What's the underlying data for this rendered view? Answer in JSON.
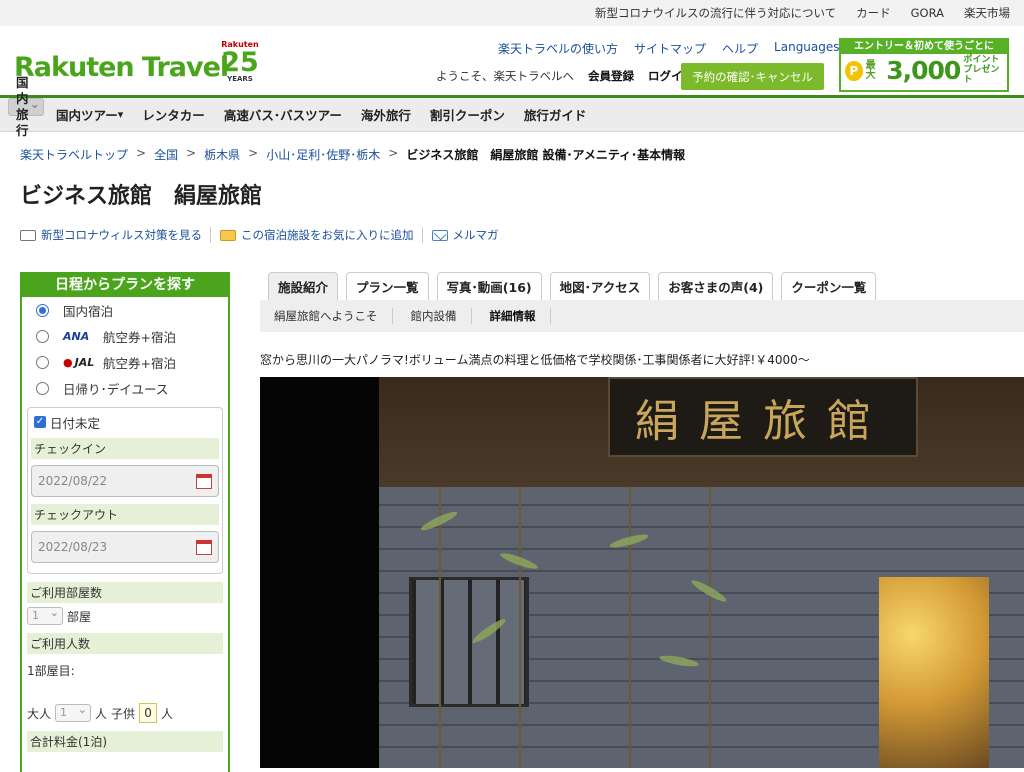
{
  "topbar": {
    "links": [
      "新型コロナウイルスの流行に伴う対応について",
      "カード",
      "GORA",
      "楽天市場"
    ]
  },
  "header": {
    "logo": "Rakuten Travel",
    "anniv": {
      "brand": "Rakuten",
      "number": "25",
      "word": "YEARS"
    },
    "links": [
      "楽天トラベルの使い方",
      "サイトマップ",
      "ヘルプ",
      "Languages"
    ],
    "welcome": "ようこそ、楽天トラベルへ",
    "register": "会員登録",
    "login": "ログイン",
    "reservation": "予約の確認･キャンセル",
    "promo": {
      "top": "エントリー＆初めて使うごとに",
      "coin": "P",
      "max": "最大",
      "amount": "3,000",
      "unit1": "ポイント",
      "unit2": "プレゼント"
    }
  },
  "nav": [
    "国内旅行",
    "国内ツアー",
    "レンタカー",
    "高速バス･バスツアー",
    "海外旅行",
    "割引クーポン",
    "旅行ガイド"
  ],
  "breadcrumb": {
    "items": [
      "楽天トラベルトップ",
      "全国",
      "栃木県",
      "小山･足利･佐野･栃木"
    ],
    "sep": ">",
    "current": "ビジネス旅館　絹屋旅館 設備･アメニティ･基本情報"
  },
  "title": "ビジネス旅館　絹屋旅館",
  "actions": [
    "新型コロナウィルス対策を見る",
    "この宿泊施設をお気に入りに追加",
    "メルマガ"
  ],
  "sidebar": {
    "heading": "日程からプランを探す",
    "radios": [
      {
        "label": "国内宿泊",
        "brand": ""
      },
      {
        "label": "航空券+宿泊",
        "brand": "ANA"
      },
      {
        "label": "航空券+宿泊",
        "brand": "JAL"
      },
      {
        "label": "日帰り･デイユース",
        "brand": ""
      }
    ],
    "undecided": "日付未定",
    "checkin_label": "チェックイン",
    "checkin": "2022/08/22",
    "checkout_label": "チェックアウト",
    "checkout": "2022/08/23",
    "rooms_label": "ご利用部屋数",
    "rooms_value": "1",
    "rooms_unit": "部屋",
    "people_label": "ご利用人数",
    "room1": "1部屋目:",
    "adult": "大人",
    "adult_value": "1",
    "unit_person": "人",
    "child": "子供",
    "child_value": "0",
    "total_label": "合計料金(1泊)"
  },
  "tabs": [
    "施設紹介",
    "プラン一覧",
    "写真･動画(16)",
    "地図･アクセス",
    "お客さまの声(4)",
    "クーポン一覧"
  ],
  "subtabs": [
    "絹屋旅館へようこそ",
    "館内設備",
    "詳細情報"
  ],
  "caption": "窓から思川の一大パノラマ!ボリューム満点の料理と低価格で学校関係･工事関係者に大好評!￥4000～",
  "photo": {
    "sign": "絹屋旅館"
  }
}
